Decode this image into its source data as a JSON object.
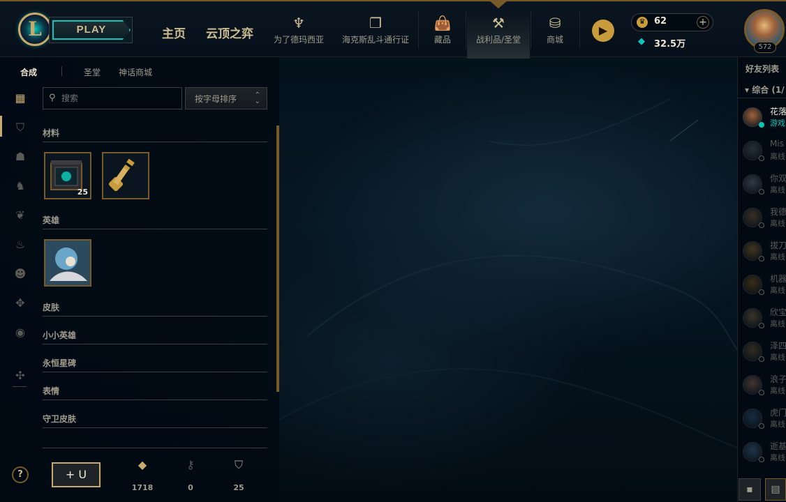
{
  "header": {
    "logo_letter": "L",
    "play_label": "PLAY",
    "main_nav": [
      "主页",
      "云顶之弈"
    ],
    "nav_items": [
      {
        "label": "为了德玛西亚",
        "icon": "trident-icon"
      },
      {
        "label": "海克斯乱斗通行证",
        "icon": "cards-icon"
      },
      {
        "label": "藏品",
        "icon": "bag-icon"
      },
      {
        "label": "战利品/圣堂",
        "icon": "crafting-icon",
        "active": true
      },
      {
        "label": "商城",
        "icon": "coins-icon"
      }
    ],
    "rp_value": "62",
    "be_value": "32.5万",
    "add_label": "+",
    "level": "572"
  },
  "loot": {
    "subtabs": [
      "合成",
      "圣堂",
      "神话商城"
    ],
    "active_subtab": "合成",
    "search_placeholder": "搜索",
    "sort_label": "按字母排序",
    "sections": [
      "材料",
      "英雄",
      "皮肤",
      "小小英雄",
      "永恒星碑",
      "表情",
      "守卫皮肤"
    ],
    "materials": [
      {
        "name": "hextech-chest",
        "count": "25"
      },
      {
        "name": "hextech-key",
        "count": ""
      }
    ],
    "champions": [
      {
        "name": "champion-shard",
        "count": ""
      }
    ],
    "bottom": {
      "help": "?",
      "add_capsule": "+ U",
      "essence": "1718",
      "keys": "0",
      "chests": "25"
    }
  },
  "friends": {
    "title": "好友列表",
    "group": "▾ 综合 (1/",
    "rows": [
      {
        "name": "花落",
        "status": "游戏",
        "online": true
      },
      {
        "name": "Mis",
        "status": "离线",
        "online": false
      },
      {
        "name": "你双",
        "status": "离线",
        "online": false
      },
      {
        "name": "我德",
        "status": "离线",
        "online": false
      },
      {
        "name": "拔刀",
        "status": "离线",
        "online": false
      },
      {
        "name": "机器",
        "status": "离线",
        "online": false
      },
      {
        "name": "欣宝",
        "status": "离线",
        "online": false
      },
      {
        "name": "泽四",
        "status": "离线",
        "online": false
      },
      {
        "name": "浪子",
        "status": "离线",
        "online": false
      },
      {
        "name": "虎门",
        "status": "离线",
        "online": false
      },
      {
        "name": "逝基",
        "status": "离线",
        "online": false
      }
    ]
  },
  "colors": {
    "gold": "#c8aa6e",
    "gold_dark": "#785a28",
    "teal": "#0ac8b9",
    "text": "#a09b8c",
    "bg": "#010a13"
  }
}
